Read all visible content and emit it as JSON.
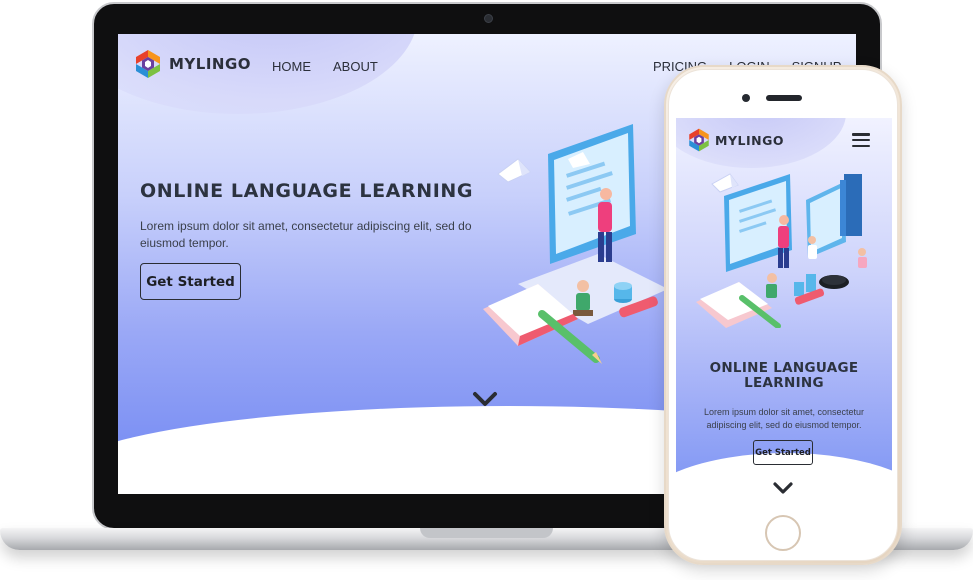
{
  "laptop": {
    "brand": "MYLINGO",
    "nav": {
      "home": "HOME",
      "about": "ABOUT",
      "pricing": "PRICING",
      "login": "LOGIN",
      "signup": "SIGNUP"
    },
    "hero": {
      "title": "ONLINE LANGUAGE LEARNING",
      "description": "Lorem ipsum dolor sit amet, consectetur adipiscing elit, sed do eiusmod tempor.",
      "cta": "Get Started"
    }
  },
  "phone": {
    "brand": "MYLINGO",
    "hero": {
      "title": "ONLINE LANGUAGE LEARNING",
      "description": "Lorem ipsum dolor sit amet, consectetur adipiscing elit, sed do eiusmod tempor.",
      "cta": "Get Started"
    }
  },
  "icons": {
    "logo": "mylingo-logo-icon",
    "menu": "hamburger-menu-icon",
    "scroll": "chevron-down-icon",
    "illustration": "online-learning-illustration"
  },
  "colors": {
    "text_dark": "#2c3340",
    "gradient_top": "#eef1ff",
    "gradient_bottom": "#6f86f2",
    "logo_orange": "#f7941d",
    "logo_purple": "#6b3fa0",
    "logo_blue": "#2a8fd6",
    "logo_green": "#7cc142",
    "logo_red": "#e8412b"
  }
}
